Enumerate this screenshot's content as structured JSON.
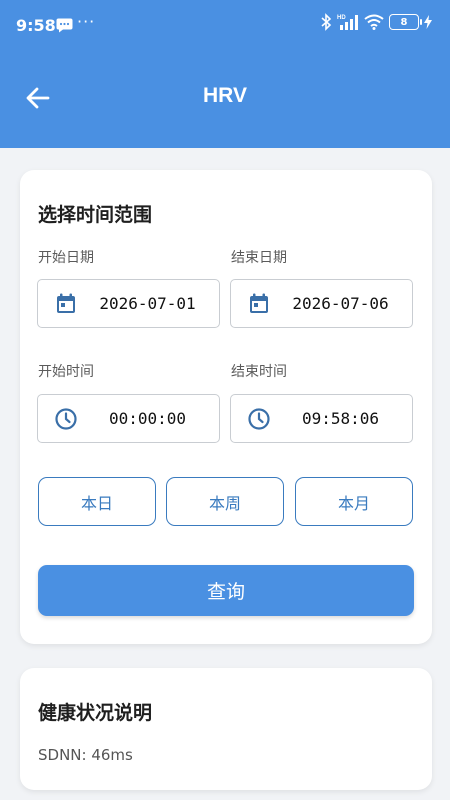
{
  "status_bar": {
    "time": "9:58",
    "dots": "···",
    "battery": "8"
  },
  "toolbar": {
    "title": "HRV"
  },
  "range_card": {
    "title": "选择时间范围",
    "start_date_label": "开始日期",
    "start_date_value": "2026-07-01",
    "end_date_label": "结束日期",
    "end_date_value": "2026-07-06",
    "start_time_label": "开始时间",
    "start_time_value": "00:00:00",
    "end_time_label": "结束时间",
    "end_time_value": "09:58:06",
    "today_label": "本日",
    "week_label": "本周",
    "month_label": "本月",
    "query_label": "查询"
  },
  "health_card": {
    "title": "健康状况说明",
    "sdnn": "SDNN: 46ms"
  },
  "icons": {
    "back": "arrow-left-icon",
    "calendar": "calendar-icon",
    "clock": "clock-icon",
    "bluetooth": "bluetooth-icon",
    "signal": "signal-icon",
    "wifi": "wifi-icon",
    "battery": "battery-icon",
    "charging": "charging-icon",
    "message": "message-icon"
  },
  "colors": {
    "primary": "#4a90e2",
    "outline": "#3a7bbf",
    "icon": "#3a6fa8"
  }
}
